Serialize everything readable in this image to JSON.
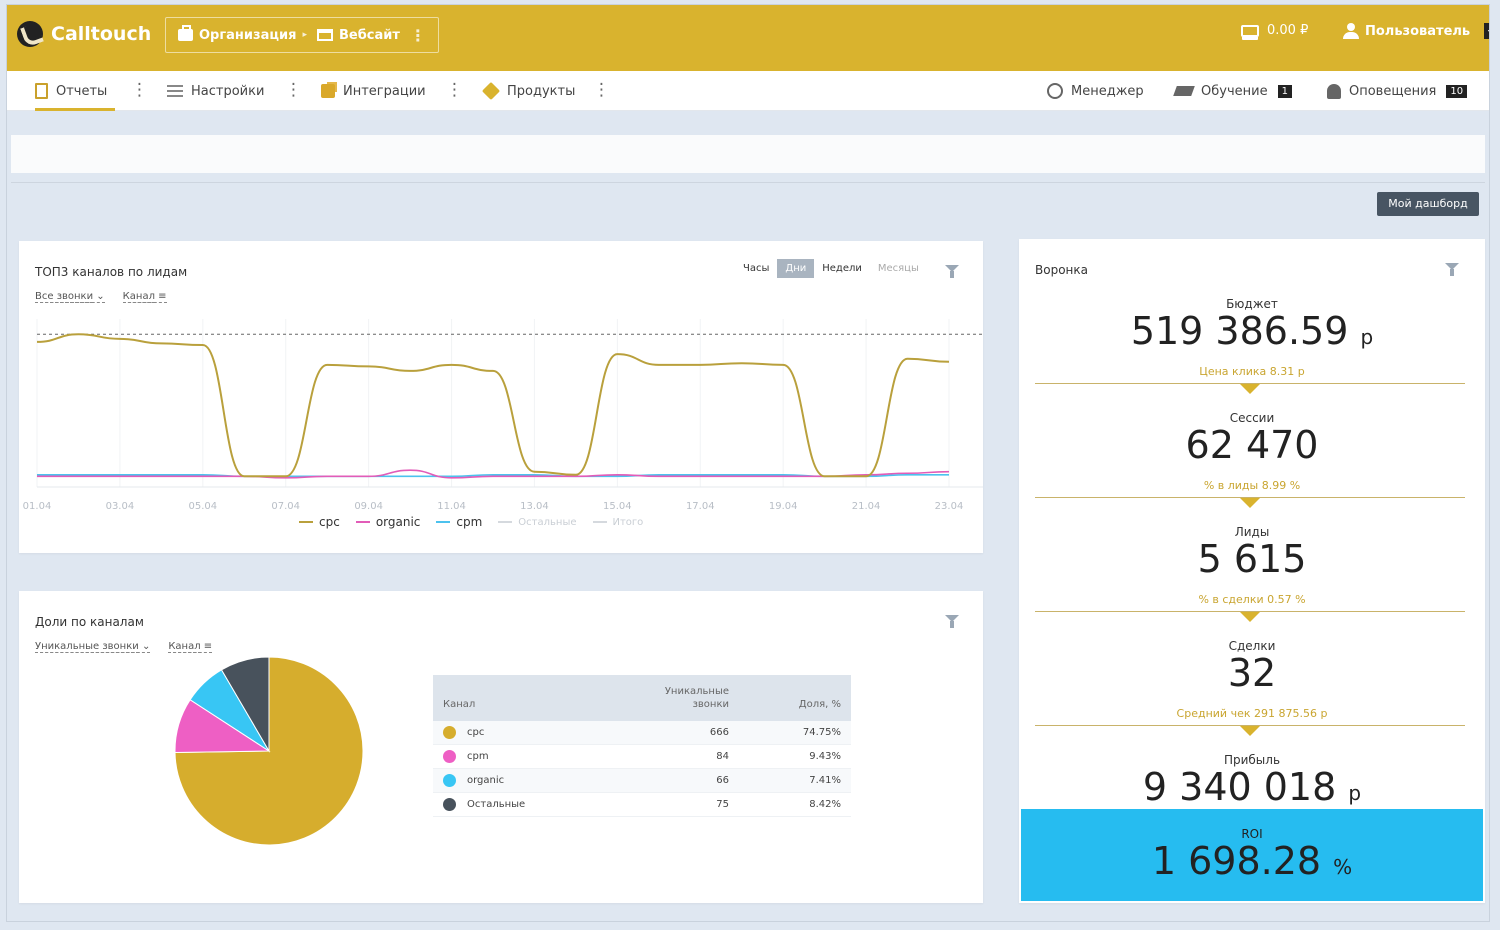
{
  "app": {
    "name": "Calltouch"
  },
  "breadcrumb": {
    "org": "Организация",
    "site": "Вебсайт"
  },
  "balance": "0.00 ₽",
  "user": "Пользователь",
  "nav": {
    "reports": "Отчеты",
    "settings": "Настройки",
    "integrations": "Интеграции",
    "products": "Продукты",
    "manager": "Менеджер",
    "learning": "Обучение",
    "learning_badge": "1",
    "notifications": "Оповещения",
    "notifications_badge": "10"
  },
  "dashboard_button": "Мой дашборд",
  "top_chart": {
    "title": "ТОП3 каналов по лидам",
    "filter_calls": "Все звонки",
    "filter_channel": "Канал",
    "periods": [
      "Часы",
      "Дни",
      "Недели",
      "Месяцы"
    ],
    "selected_period": "Дни"
  },
  "pie_panel": {
    "title": "Доли по каналам",
    "filter_calls": "Уникальные звонки",
    "filter_channel": "Канал",
    "table_headers": {
      "channel": "Канал",
      "unique_calls": "Уникальные звонки",
      "share": "Доля, %"
    }
  },
  "chart_data": [
    {
      "type": "line",
      "title": "ТОП3 каналов по лидам",
      "x": [
        "01.04",
        "02.04",
        "03.04",
        "04.04",
        "05.04",
        "06.04",
        "07.04",
        "08.04",
        "09.04",
        "10.04",
        "11.04",
        "12.04",
        "13.04",
        "14.04",
        "15.04",
        "16.04",
        "17.04",
        "18.04",
        "19.04",
        "20.04",
        "21.04",
        "22.04",
        "23.04"
      ],
      "tick_labels": [
        "01.04",
        "03.04",
        "05.04",
        "07.04",
        "09.04",
        "11.04",
        "13.04",
        "15.04",
        "17.04",
        "19.04",
        "21.04",
        "23.04"
      ],
      "series": [
        {
          "name": "cpc",
          "color": "#b9a03c",
          "values": [
            95,
            100,
            97,
            94,
            93,
            7,
            7,
            80,
            79,
            76,
            80,
            76,
            10,
            8,
            87,
            80,
            80,
            81,
            80,
            7,
            7,
            84,
            82
          ]
        },
        {
          "name": "organic",
          "color": "#e25cb8",
          "values": [
            7,
            7,
            7,
            7,
            7,
            7,
            6,
            7,
            7,
            11,
            6,
            7,
            7,
            7,
            8,
            7,
            7,
            7,
            7,
            7,
            8,
            9,
            10
          ]
        },
        {
          "name": "cpm",
          "color": "#4cc2ee",
          "values": [
            8,
            8,
            8,
            8,
            8,
            7,
            7,
            7,
            7,
            7,
            7,
            8,
            8,
            7,
            7,
            8,
            8,
            8,
            8,
            7,
            7,
            8,
            8
          ]
        }
      ],
      "legend_extra": [
        "Остальные",
        "Итого"
      ],
      "ylim": [
        0,
        110
      ],
      "reference_line": 100,
      "legend_position": "bottom"
    },
    {
      "type": "pie",
      "title": "Доли по каналам",
      "slices": [
        {
          "label": "cpc",
          "unique_calls": 666,
          "share_text": "74.75%",
          "value": 74.75,
          "color": "#d6ad2d"
        },
        {
          "label": "cpm",
          "unique_calls": 84,
          "share_text": "9.43%",
          "value": 9.43,
          "color": "#ee5fc4"
        },
        {
          "label": "organic",
          "unique_calls": 66,
          "share_text": "7.41%",
          "value": 7.41,
          "color": "#38c6f4"
        },
        {
          "label": "Остальные",
          "unique_calls": 75,
          "share_text": "8.42%",
          "value": 8.42,
          "color": "#48525c"
        }
      ]
    }
  ],
  "funnel": {
    "title": "Воронка",
    "budget_label": "Бюджет",
    "budget_value": "519 386.59",
    "budget_unit": "р",
    "click_price": "Цена клика 8.31 р",
    "sessions_label": "Сессии",
    "sessions_value": "62 470",
    "sessions_note": "% в лиды 8.99 %",
    "leads_label": "Лиды",
    "leads_value": "5 615",
    "leads_note": "% в сделки 0.57 %",
    "deals_label": "Сделки",
    "deals_value": "32",
    "deals_note": "Средний чек 291 875.56 р",
    "profit_label": "Прибыль",
    "profit_value": "9 340 018",
    "profit_unit": "р",
    "roi_label": "ROI",
    "roi_value": "1 698.28",
    "roi_unit": "%"
  }
}
